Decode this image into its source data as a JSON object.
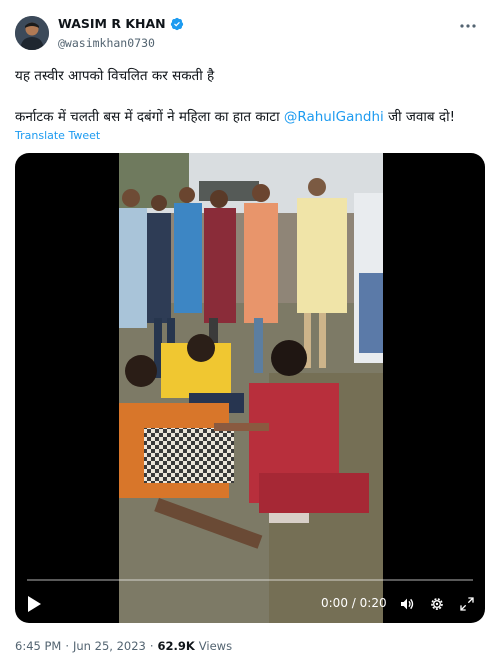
{
  "author": {
    "name": "WASIM R KHAN",
    "handle": "@wasimkhan0730",
    "verified": true,
    "verified_color": "#1d9bf0",
    "avatar_icon": "profile-avatar"
  },
  "more_icon": "more-horizontal-icon",
  "tweet": {
    "line1": "यह तस्वीर आपको विचलित कर सकती है",
    "line2_text": "कर्नाटक में चलती बस में दबंगों ने महिला का हात काटा",
    "mention": "@RahulGandhi",
    "line2_suffix": "जी जवाब दो!",
    "translate_label": "Translate Tweet"
  },
  "video": {
    "current_time": "0:00",
    "separator": "/",
    "duration": "0:20",
    "progress_fraction": 0.0,
    "icons": [
      "play-icon",
      "volume-icon",
      "settings-gear-icon",
      "fullscreen-icon"
    ]
  },
  "footer": {
    "time": "6:45 PM",
    "dot1": "·",
    "date": "Jun 25, 2023",
    "dot2": "·",
    "views_count": "62.9K",
    "views_label": "Views"
  },
  "colors": {
    "link": "#1d9bf0",
    "text": "#0f1419",
    "muted": "#536471",
    "video_bg": "#000000"
  }
}
